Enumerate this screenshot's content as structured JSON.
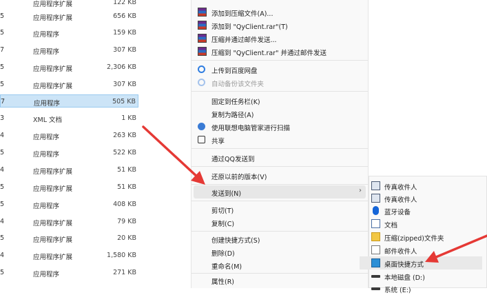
{
  "file_list": [
    {
      "num": "",
      "type": "应用程序扩展",
      "size": "122 KB"
    },
    {
      "num": "5",
      "type": "应用程序扩展",
      "size": "656 KB"
    },
    {
      "num": "5",
      "type": "应用程序",
      "size": "159 KB"
    },
    {
      "num": "7",
      "type": "应用程序",
      "size": "307 KB"
    },
    {
      "num": "5",
      "type": "应用程序扩展",
      "size": "2,306 KB"
    },
    {
      "num": "5",
      "type": "应用程序扩展",
      "size": "307 KB"
    },
    {
      "num": "7",
      "type": "应用程序",
      "size": "505 KB",
      "selected": true
    },
    {
      "num": "3",
      "type": "XML 文档",
      "size": "1 KB"
    },
    {
      "num": "4",
      "type": "应用程序",
      "size": "263 KB"
    },
    {
      "num": "5",
      "type": "应用程序",
      "size": "522 KB"
    },
    {
      "num": "4",
      "type": "应用程序扩展",
      "size": "51 KB"
    },
    {
      "num": "5",
      "type": "应用程序扩展",
      "size": "51 KB"
    },
    {
      "num": "5",
      "type": "应用程序",
      "size": "408 KB"
    },
    {
      "num": "4",
      "type": "应用程序扩展",
      "size": "79 KB"
    },
    {
      "num": "5",
      "type": "应用程序扩展",
      "size": "20 KB"
    },
    {
      "num": "4",
      "type": "应用程序扩展",
      "size": "1,580 KB"
    },
    {
      "num": "5",
      "type": "应用程序",
      "size": "271 KB"
    }
  ],
  "context_menu": {
    "items": [
      {
        "label": "添加到压缩文件(A)...",
        "icon": "winrar-icon"
      },
      {
        "label": "添加到 \"QyClient.rar\"(T)",
        "icon": "winrar-icon"
      },
      {
        "label": "压缩并通过邮件发送...",
        "icon": "winrar-icon"
      },
      {
        "label": "压缩到 \"QyClient.rar\" 并通过邮件发送",
        "icon": "winrar-icon"
      },
      {
        "label": "上传到百度网盘",
        "icon": "baidu-netdisk-icon"
      },
      {
        "label": "自动备份该文件夹",
        "icon": "baidu-netdisk-icon",
        "disabled": true
      },
      {
        "label": "固定到任务栏(K)",
        "icon": ""
      },
      {
        "label": "复制为路径(A)",
        "icon": ""
      },
      {
        "label": "使用联想电脑管家进行扫描",
        "icon": "lenovo-icon"
      },
      {
        "label": "共享",
        "icon": "share-icon"
      },
      {
        "label": "通过QQ发送到",
        "icon": ""
      },
      {
        "label": "还原以前的版本(V)",
        "icon": ""
      },
      {
        "label": "发送到(N)",
        "icon": "",
        "submenu_arrow": "›",
        "highlighted": true
      },
      {
        "label": "剪切(T)",
        "icon": ""
      },
      {
        "label": "复制(C)",
        "icon": ""
      },
      {
        "label": "创建快捷方式(S)",
        "icon": ""
      },
      {
        "label": "删除(D)",
        "icon": ""
      },
      {
        "label": "重命名(M)",
        "icon": ""
      },
      {
        "label": "属性(R)",
        "icon": ""
      }
    ]
  },
  "send_to_menu": {
    "items": [
      {
        "label": "传真收件人",
        "icon": "fax-icon"
      },
      {
        "label": "传真收件人",
        "icon": "fax-icon"
      },
      {
        "label": "蓝牙设备",
        "icon": "bluetooth-icon"
      },
      {
        "label": "文档",
        "icon": "document-icon"
      },
      {
        "label": "压缩(zipped)文件夹",
        "icon": "zip-folder-icon"
      },
      {
        "label": "邮件收件人",
        "icon": "mail-icon"
      },
      {
        "label": "桌面快捷方式",
        "icon": "desktop-icon",
        "highlighted": true
      },
      {
        "label": "本地磁盘 (D:)",
        "icon": "drive-icon"
      },
      {
        "label": "系统 (E:)",
        "icon": "drive-icon"
      }
    ]
  },
  "colors": {
    "annotation_arrow": "#e53935",
    "selection": "#cce4f7",
    "menu_bg": "#f9f9f9"
  }
}
